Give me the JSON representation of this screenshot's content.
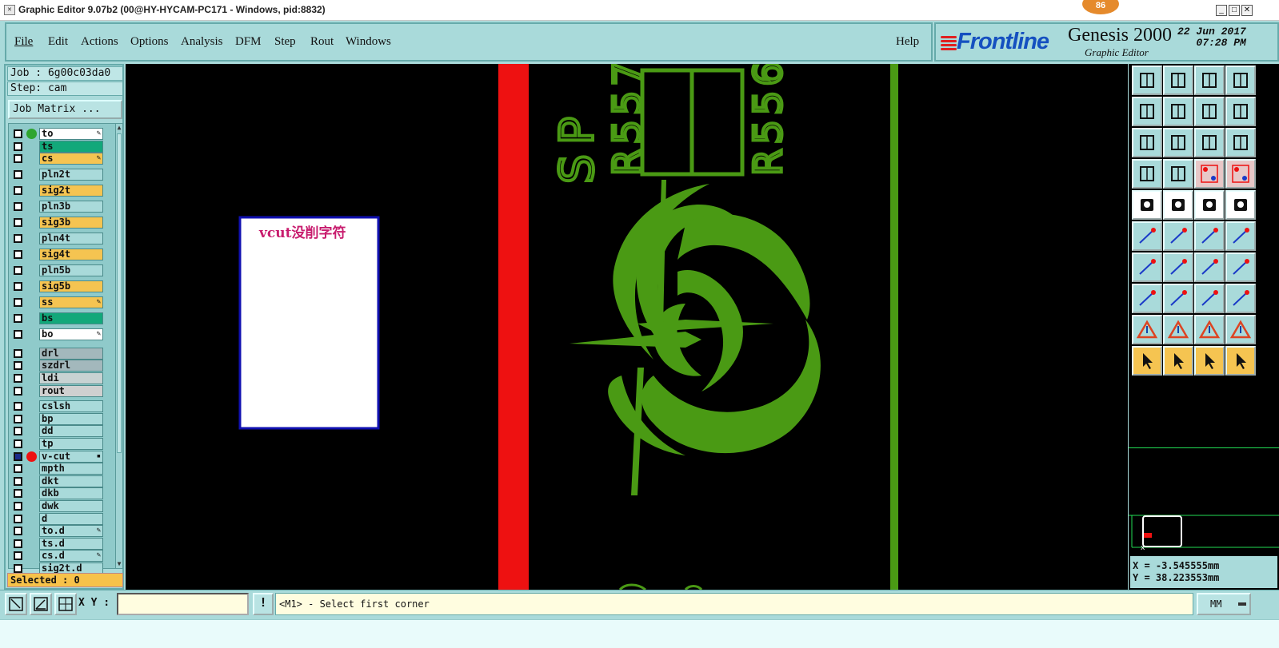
{
  "window": {
    "title": "Graphic Editor 9.07b2 (00@HY-HYCAM-PC171 - Windows, pid:8832)",
    "badge": "86"
  },
  "menu": [
    "File",
    "Edit",
    "Actions",
    "Options",
    "Analysis",
    "DFM",
    "Step",
    "Rout",
    "Windows"
  ],
  "help": "Help",
  "branding": {
    "logo": "Frontline",
    "product": "Genesis 2000",
    "subtitle": "Graphic Editor",
    "date": "22 Jun 2017",
    "time": "07:28 PM"
  },
  "job": {
    "job_line": "Job : 6g00c03da0",
    "step_line": "Step: cam",
    "matrix_button": "Job Matrix ..."
  },
  "layers": [
    {
      "name": "to",
      "color": "#ffffff",
      "dot": "#2fa52f",
      "pen": true,
      "checked": false
    },
    {
      "name": "ts",
      "color": "#12a87a",
      "dot": "",
      "pen": false,
      "checked": false
    },
    {
      "name": "cs",
      "color": "#f5c451",
      "dot": "",
      "pen": true,
      "checked": false
    },
    {
      "name": "pln2t",
      "color": "#a9dada",
      "dot": "",
      "pen": false,
      "checked": false
    },
    {
      "name": "sig2t",
      "color": "#f5c451",
      "dot": "",
      "pen": false,
      "checked": false
    },
    {
      "name": "pln3b",
      "color": "#a9dada",
      "dot": "",
      "pen": false,
      "checked": false
    },
    {
      "name": "sig3b",
      "color": "#f5c451",
      "dot": "",
      "pen": false,
      "checked": false
    },
    {
      "name": "pln4t",
      "color": "#a9dada",
      "dot": "",
      "pen": false,
      "checked": false
    },
    {
      "name": "sig4t",
      "color": "#f5c451",
      "dot": "",
      "pen": false,
      "checked": false
    },
    {
      "name": "pln5b",
      "color": "#a9dada",
      "dot": "",
      "pen": false,
      "checked": false
    },
    {
      "name": "sig5b",
      "color": "#f5c451",
      "dot": "",
      "pen": false,
      "checked": false
    },
    {
      "name": "ss",
      "color": "#f5c451",
      "dot": "",
      "pen": true,
      "checked": false
    },
    {
      "name": "bs",
      "color": "#12a87a",
      "dot": "",
      "pen": false,
      "checked": false
    },
    {
      "name": "bo",
      "color": "#ffffff",
      "dot": "",
      "pen": true,
      "checked": false
    },
    {
      "name": "drl",
      "color": "#a3b8bc",
      "dot": "",
      "pen": false,
      "checked": false
    },
    {
      "name": "szdrl",
      "color": "#a3b8bc",
      "dot": "",
      "pen": false,
      "checked": false
    },
    {
      "name": "ldi",
      "color": "#c8d2d2",
      "dot": "",
      "pen": false,
      "checked": false
    },
    {
      "name": "rout",
      "color": "#d0d0d0",
      "dot": "",
      "pen": false,
      "checked": false
    },
    {
      "name": "cslsh",
      "color": "#a9dada",
      "dot": "",
      "pen": false,
      "checked": false
    },
    {
      "name": "bp",
      "color": "#a9dada",
      "dot": "",
      "pen": false,
      "checked": false
    },
    {
      "name": "dd",
      "color": "#a9dada",
      "dot": "",
      "pen": false,
      "checked": false
    },
    {
      "name": "tp",
      "color": "#a9dada",
      "dot": "",
      "pen": false,
      "checked": false
    },
    {
      "name": "v-cut",
      "color": "#a9dada",
      "dot": "#ee1111",
      "pen": false,
      "checked": true,
      "mark": "▪"
    },
    {
      "name": "mpth",
      "color": "#a9dada",
      "dot": "",
      "pen": false,
      "checked": false
    },
    {
      "name": "dkt",
      "color": "#a9dada",
      "dot": "",
      "pen": false,
      "checked": false
    },
    {
      "name": "dkb",
      "color": "#a9dada",
      "dot": "",
      "pen": false,
      "checked": false
    },
    {
      "name": "dwk",
      "color": "#a9dada",
      "dot": "",
      "pen": false,
      "checked": false
    },
    {
      "name": "d",
      "color": "#a9dada",
      "dot": "",
      "pen": false,
      "checked": false
    },
    {
      "name": "to.d",
      "color": "#a9dada",
      "dot": "",
      "pen": true,
      "checked": false
    },
    {
      "name": "ts.d",
      "color": "#a9dada",
      "dot": "",
      "pen": false,
      "checked": false
    },
    {
      "name": "cs.d",
      "color": "#a9dada",
      "dot": "",
      "pen": true,
      "checked": false
    },
    {
      "name": "sig2t.d",
      "color": "#a9dada",
      "dot": "",
      "pen": false,
      "checked": false
    }
  ],
  "selected": "Selected : 0",
  "canvas": {
    "note_text": "vcut没削字符",
    "refdes": [
      "S",
      "P",
      "R557",
      "R556"
    ],
    "colors": {
      "trace": "#4a9a14",
      "vcut": "#ee1111",
      "background": "#000000",
      "note_border": "#1010b0",
      "note_text": "#c81c6e"
    }
  },
  "coords": {
    "x_text": "X = -3.545555mm",
    "y_text": "Y = 38.223553mm"
  },
  "bottom": {
    "xy_label": "X Y :",
    "xy_value": "",
    "excl": "!",
    "prompt": "<M1> - Select first corner",
    "units": "MM"
  }
}
